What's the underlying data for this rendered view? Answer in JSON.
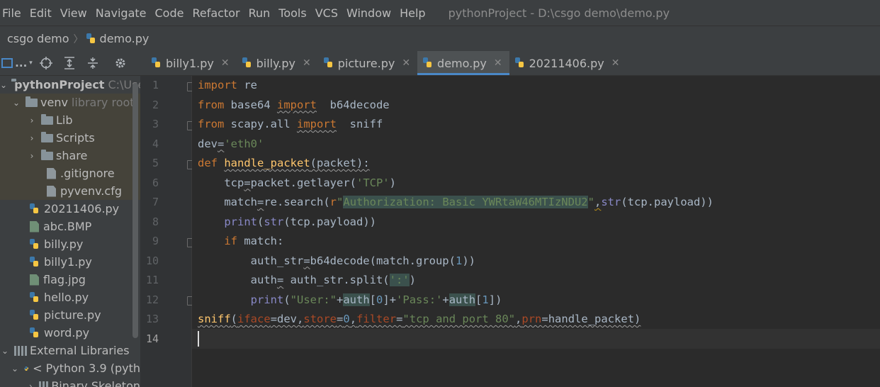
{
  "menu": [
    "File",
    "Edit",
    "View",
    "Navigate",
    "Code",
    "Refactor",
    "Run",
    "Tools",
    "VCS",
    "Window",
    "Help"
  ],
  "window_title": "pythonProject - D:\\csgo demo\\demo.py",
  "breadcrumb": {
    "folder": "csgo demo",
    "file": "demo.py"
  },
  "project_toolbar": {
    "view_mode": "..."
  },
  "tabs": [
    {
      "label": "billy1.py",
      "active": false
    },
    {
      "label": "billy.py",
      "active": false
    },
    {
      "label": "picture.py",
      "active": false
    },
    {
      "label": "demo.py",
      "active": true
    },
    {
      "label": "20211406.py",
      "active": false
    }
  ],
  "tree": {
    "root_label": "pythonProject",
    "root_path": "C:\\Use",
    "venv_label": "venv",
    "venv_note": "library root",
    "items": [
      "Lib",
      "Scripts",
      "share",
      ".gitignore",
      "pyvenv.cfg",
      "20211406.py",
      "abc.BMP",
      "billy.py",
      "billy1.py",
      "flag.jpg",
      "hello.py",
      "picture.py",
      "word.py"
    ],
    "external_libraries": "External Libraries",
    "python_sdk": "< Python 3.9 (pyth",
    "binary_skeletons": "Binary Skeleton"
  },
  "line_numbers": [
    "1",
    "2",
    "3",
    "4",
    "5",
    "6",
    "7",
    "8",
    "9",
    "10",
    "11",
    "12",
    "13",
    "14"
  ],
  "code": {
    "l1_kw": "import",
    "l1_rest": " re",
    "l2_kw": "from",
    "l2_mod": " base64 ",
    "l2_kw2": "import",
    "l2_name": "  b64decode",
    "l3_kw": "from",
    "l3_mod": " scapy.all ",
    "l3_kw2": "import",
    "l3_name": "  sniff",
    "l4_a": "dev",
    "l4_eq": "=",
    "l4_str": "'eth0'",
    "l5_kw": "def",
    "l5_fn": "handle_packet",
    "l5_rest": "(packet):",
    "l6_a": "    tcp",
    "l6_eq": "=",
    "l6_b": "packet.getlayer(",
    "l6_str": "'TCP'",
    "l6_c": ")",
    "l7_a": "    match",
    "l7_eq": "=",
    "l7_b": "re.search(",
    "l7_r": "r",
    "l7_q1": "\"",
    "l7_str": "Authorization: Basic YWRtaW46MTIzNDU2",
    "l7_q2": "\"",
    "l7_comma": ",",
    "l7_bi": "str",
    "l7_c": "(tcp.payload))",
    "l8_a": "    ",
    "l8_bi1": "print",
    "l8_b": "(",
    "l8_bi2": "str",
    "l8_c": "(tcp.payload))",
    "l9_a": "    ",
    "l9_kw": "if",
    "l9_b": " match:",
    "l10_a": "        auth_str",
    "l10_eq": "=",
    "l10_b": "b64decode(match.group(",
    "l10_num": "1",
    "l10_c": "))",
    "l11_a": "        auth",
    "l11_eq": "=",
    "l11_b": " auth_str.split(",
    "l11_str": "':'",
    "l11_c": ")",
    "l12_a": "        ",
    "l12_bi": "print",
    "l12_b": "(",
    "l12_str1": "\"User:\"",
    "l12_p1": "+",
    "l12_v1": "auth",
    "l12_i1a": "[",
    "l12_n1": "0",
    "l12_i1b": "]",
    "l12_p2": "+",
    "l12_str2": "'Pass:'",
    "l12_p3": "+",
    "l12_v2": "auth",
    "l12_i2a": "[",
    "l12_n2": "1",
    "l12_i2b": "]",
    "l12_c": ")",
    "l13_fn": "sniff",
    "l13_b": "(",
    "l13_k1": "iface",
    "l13_e1": "=dev,",
    "l13_k2": "store",
    "l13_e2": "=",
    "l13_n": "0",
    "l13_cm": ",",
    "l13_k3": "filter",
    "l13_e3": "=",
    "l13_str": "\"tcp and port 80\"",
    "l13_cm2": ",",
    "l13_k4": "prn",
    "l13_e4": "=handle_packet)"
  },
  "colors": {
    "keyword": "#cc7832",
    "string": "#6a8759",
    "number": "#6897bb",
    "builtin": "#8888c6",
    "function": "#ffc66d",
    "accent": "#4a88c7"
  }
}
